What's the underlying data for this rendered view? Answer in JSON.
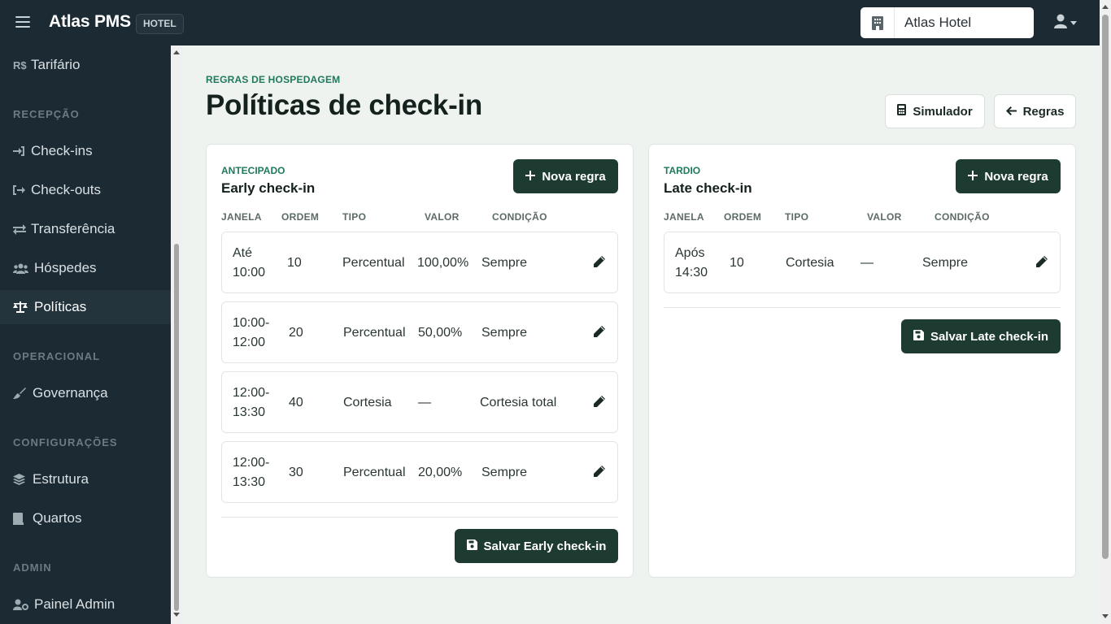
{
  "header": {
    "brand": "Atlas PMS",
    "badge": "HOTEL",
    "hotel_name": "Atlas Hotel"
  },
  "sidebar": {
    "items": [
      {
        "label": "Tarifário",
        "icon": "R$"
      },
      {
        "label": "Check-ins",
        "icon": "check-in-icon"
      },
      {
        "label": "Check-outs",
        "icon": "check-out-icon"
      },
      {
        "label": "Transferência",
        "icon": "transfer-icon"
      },
      {
        "label": "Hóspedes",
        "icon": "users-icon"
      },
      {
        "label": "Políticas",
        "icon": "scale-icon"
      },
      {
        "label": "Governança",
        "icon": "broom-icon"
      },
      {
        "label": "Estrutura",
        "icon": "layers-icon"
      },
      {
        "label": "Quartos",
        "icon": "bed-icon"
      },
      {
        "label": "Painel Admin",
        "icon": "user-gear-icon"
      }
    ],
    "sections": [
      "RECEPÇÃO",
      "OPERACIONAL",
      "CONFIGURAÇÕES",
      "ADMIN"
    ]
  },
  "page": {
    "eyebrow": "REGRAS DE HOSPEDAGEM",
    "title": "Políticas de check-in",
    "simulator_label": "Simulador",
    "back_label": "Regras"
  },
  "columns": [
    "JANELA",
    "ORDEM",
    "TIPO",
    "VALOR",
    "CONDIÇÃO"
  ],
  "early": {
    "eyebrow": "ANTECIPADO",
    "title": "Early check-in",
    "new_label": "Nova regra",
    "save_label": "Salvar Early check-in",
    "rows": [
      {
        "window1": "Até",
        "window2": "10:00",
        "order": "10",
        "type": "Percentual",
        "value": "100,00%",
        "condition": "Sempre"
      },
      {
        "window1": "10:00-",
        "window2": "12:00",
        "order": "20",
        "type": "Percentual",
        "value": "50,00%",
        "condition": "Sempre"
      },
      {
        "window1": "12:00-",
        "window2": "13:30",
        "order": "40",
        "type": "Cortesia",
        "value": "—",
        "condition": "Cortesia total"
      },
      {
        "window1": "12:00-",
        "window2": "13:30",
        "order": "30",
        "type": "Percentual",
        "value": "20,00%",
        "condition": "Sempre"
      }
    ]
  },
  "late": {
    "eyebrow": "TARDIO",
    "title": "Late check-in",
    "new_label": "Nova regra",
    "save_label": "Salvar Late check-in",
    "rows": [
      {
        "window1": "Após",
        "window2": "14:30",
        "order": "10",
        "type": "Cortesia",
        "value": "—",
        "condition": "Sempre"
      }
    ]
  },
  "colors": {
    "sidebar_bg": "#1b2a33",
    "accent_dark": "#1e3b32",
    "accent_green": "#1f7a5c",
    "page_bg": "#eef3f0"
  }
}
